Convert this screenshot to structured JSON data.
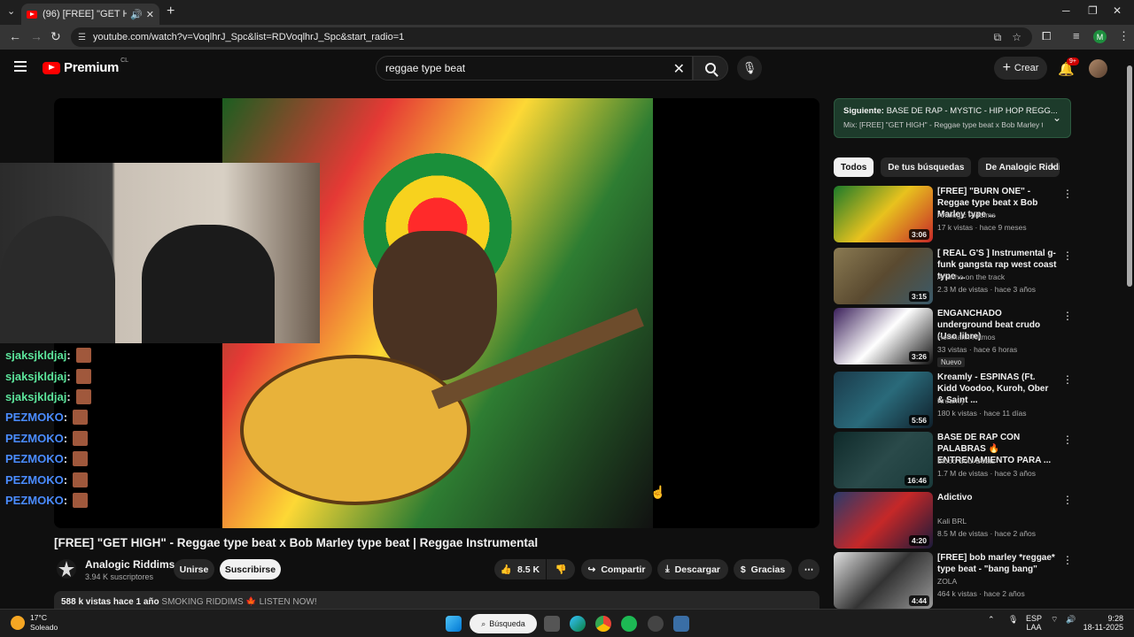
{
  "browser": {
    "tab_title": "(96) [FREE] \"GET HIGH\" - Re",
    "url": "youtube.com/watch?v=VoqlhrJ_Spc&list=RDVoqlhrJ_Spc&start_radio=1",
    "profile_initial": "M"
  },
  "header": {
    "logo_text": "Premium",
    "region": "CL",
    "search_value": "reggae type beat",
    "create_label": "Crear",
    "notif_count": "9+"
  },
  "chat": [
    {
      "user": "sjaksjkldjaj",
      "color": "#5be39a"
    },
    {
      "user": "sjaksjkldjaj",
      "color": "#5be39a"
    },
    {
      "user": "sjaksjkldjaj",
      "color": "#5be39a"
    },
    {
      "user": "PEZMOKO",
      "color": "#4a8cff"
    },
    {
      "user": "PEZMOKO",
      "color": "#4a8cff"
    },
    {
      "user": "PEZMOKO",
      "color": "#4a8cff"
    },
    {
      "user": "PEZMOKO",
      "color": "#4a8cff"
    },
    {
      "user": "PEZMOKO",
      "color": "#4a8cff"
    }
  ],
  "video": {
    "title": "[FREE] \"GET HIGH\" - Reggae type beat x Bob Marley type beat | Reggae Instrumental",
    "channel": "Analogic Riddims",
    "subscribers": "3.94 K suscriptores",
    "join_label": "Unirse",
    "subscribe_label": "Suscribirse",
    "likes": "8.5 K",
    "share_label": "Compartir",
    "download_label": "Descargar",
    "thanks_label": "Gracias",
    "views_date": "588 k vistas  hace 1 año",
    "tags": "SMOKING RIDDIMS 🍁 LISTEN NOW!"
  },
  "playlist": {
    "next_label": "Siguiente:",
    "next_title": "BASE DE RAP - MYSTIC - HIP HOP REGG...",
    "mix_title": "Mix: [FREE] \"GET HIGH\" - Reggae type beat x Bob Marley typ..."
  },
  "chips": [
    "Todos",
    "De tus búsquedas",
    "De Analogic Riddims"
  ],
  "recommendations": [
    {
      "title": "[FREE] \"BURN ONE\" - Reggae type beat x Bob Marley type ...",
      "channel": "Analogic Riddims",
      "views": "17 k vistas · hace 9 meses",
      "duration": "3:06",
      "colors": [
        "#1b7a2a",
        "#e8c21e",
        "#c62828"
      ]
    },
    {
      "title": "[ REAL G'S ] Instrumental g-funk gangsta rap west coast type ...",
      "channel": "Artacho on the track",
      "views": "2.3 M de vistas · hace 3 años",
      "duration": "3:15",
      "colors": [
        "#8a7a52",
        "#5a4a30",
        "#3a5a6a"
      ]
    },
    {
      "title": "ENGANCHADO underground beat crudo (Uso libre)",
      "channel": "Hoffmann Ritmos",
      "views": "33 vistas · hace 6 horas",
      "duration": "3:26",
      "colors": [
        "#3a1f5a",
        "#ffffff",
        "#111111"
      ],
      "badge": "Nuevo"
    },
    {
      "title": "Kreamly - ESPINAS (Ft. Kidd Voodoo, Kuroh, Ober & Saint ...",
      "channel": "Kreamly",
      "views": "180 k vistas · hace 11 días",
      "duration": "5:56",
      "colors": [
        "#1a3a4a",
        "#2a6a7a",
        "#0f1f2a"
      ]
    },
    {
      "title": "BASE DE RAP CON PALABRAS 🔥 ENTRENAMIENTO PARA ...",
      "channel": "Blood Soul Beats",
      "views": "1.7 M de vistas · hace 3 años",
      "duration": "16:46",
      "colors": [
        "#0f2a2a",
        "#2a4a4a",
        "#1a3a3a"
      ]
    },
    {
      "title": "Adictivo",
      "channel": "Kali BRL",
      "views": "8.5 M de vistas · hace 2 años",
      "duration": "4:20",
      "colors": [
        "#2a3a6a",
        "#c62828",
        "#1a1a3a"
      ]
    },
    {
      "title": "[FREE] bob marley *reggae* type beat - \"bang bang\"",
      "channel": "ZOLA",
      "views": "464 k vistas · hace 2 años",
      "duration": "4:44",
      "colors": [
        "#e0e0e0",
        "#333333",
        "#999999"
      ]
    }
  ],
  "taskbar": {
    "temp": "17°C",
    "weather": "Soleado",
    "search_label": "Búsqueda",
    "lang1": "ESP",
    "lang2": "LAA",
    "time": "9:28",
    "date": "18-11-2025"
  }
}
